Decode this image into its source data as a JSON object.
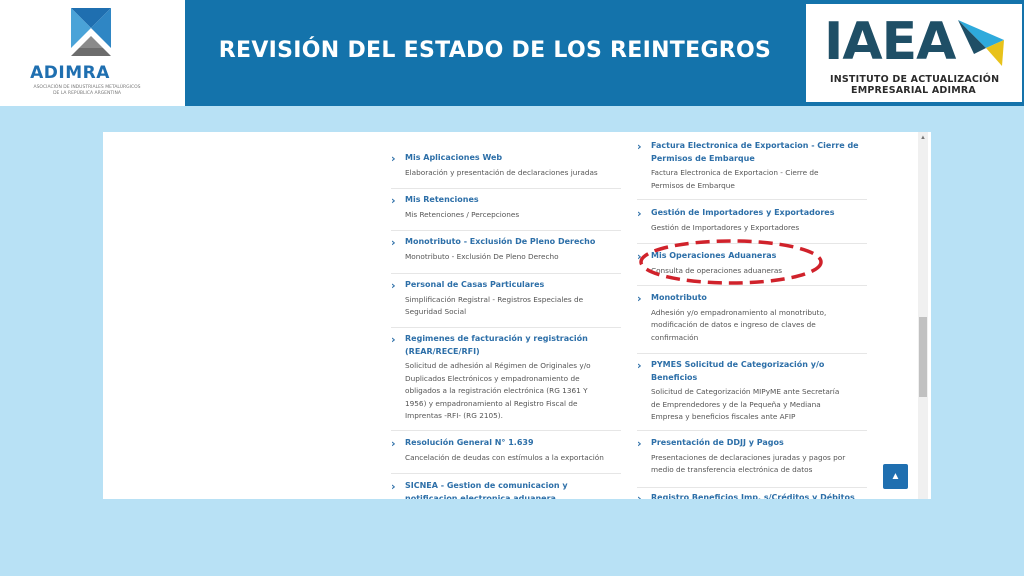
{
  "header": {
    "title": "REVISIÓN DEL ESTADO DE LOS REINTEGROS",
    "left_logo": {
      "brand": "ADIMRA",
      "subtitle_line1": "ASOCIACIÓN DE INDUSTRIALES METALÚRGICOS",
      "subtitle_line2": "DE LA REPÚBLICA ARGENTINA"
    },
    "right_logo": {
      "letters": "IAEA",
      "line1": "INSTITUTO DE ACTUALIZACIÓN",
      "line2": "EMPRESARIAL ADIMRA"
    }
  },
  "colors": {
    "header_blue": "#1473ab",
    "background": "#b8e1f5",
    "link_blue": "#2d6fa8",
    "highlight_red": "#d0222b"
  },
  "services_left": [
    {
      "title": "Mis Aplicaciones Web",
      "desc": [
        "Elaboración y presentación de declaraciones juradas"
      ]
    },
    {
      "title": "Mis Retenciones",
      "desc": [
        "Mis Retenciones / Percepciones"
      ]
    },
    {
      "title": "Monotributo - Exclusión De Pleno Derecho",
      "desc": [
        "Monotributo - Exclusión De Pleno Derecho"
      ]
    },
    {
      "title": "Personal de Casas Particulares",
      "desc": [
        "Simplificación Registral - Registros Especiales de",
        "Seguridad Social"
      ]
    },
    {
      "title_lines": [
        "Regimenes de facturación y registración",
        "(REAR/RECE/RFI)"
      ],
      "desc": [
        "Solicitud de adhesión al Régimen de Originales y/o",
        "Duplicados Electrónicos y empadronamiento de",
        "obligados a la registración electrónica (RG 1361 Y",
        "1956) y empadronamiento al Registro Fiscal de",
        "Imprentas -RFI- (RG 2105)."
      ]
    },
    {
      "title": "Resolución General N° 1.639",
      "desc": [
        "Cancelación de deudas con estímulos a la exportación"
      ]
    },
    {
      "title_lines": [
        "SICNEA - Gestion de comunicacion y",
        "notificacion electronica aduanera"
      ],
      "desc": []
    }
  ],
  "services_right": [
    {
      "title_lines": [
        "Factura Electronica de Exportacion - Cierre de",
        "Permisos de Embarque"
      ],
      "desc": [
        "Factura Electronica de Exportacion - Cierre de",
        "Permisos de Embarque"
      ]
    },
    {
      "title": "Gestión de Importadores y Exportadores",
      "desc": [
        "Gestión de Importadores y Exportadores"
      ]
    },
    {
      "title": "Mis Operaciones Aduaneras",
      "desc": [
        "Consulta de operaciones aduaneras"
      ]
    },
    {
      "title": "Monotributo",
      "desc": [
        "Adhesión y/o empadronamiento al monotributo,",
        "modificación de datos e ingreso de claves de",
        "confirmación"
      ]
    },
    {
      "title_lines": [
        "PYMES Solicitud de Categorización y/o",
        "Beneficios"
      ],
      "desc": [
        "Solicitud de Categorización MIPyME ante Secretaría",
        "de Emprendedores y de la Pequeña y Mediana",
        "Empresa y beneficios fiscales ante AFIP"
      ]
    },
    {
      "title": "Presentación de DDJJ y Pagos",
      "desc": [
        "Presentaciones de declaraciones juradas y pagos por",
        "medio de transferencia electrónica de datos"
      ]
    },
    {
      "title": "Registro Beneficios Imp. s/Créditos y Débitos",
      "desc": []
    }
  ],
  "icons": {
    "chevron": "›",
    "back_to_top": "▲"
  }
}
